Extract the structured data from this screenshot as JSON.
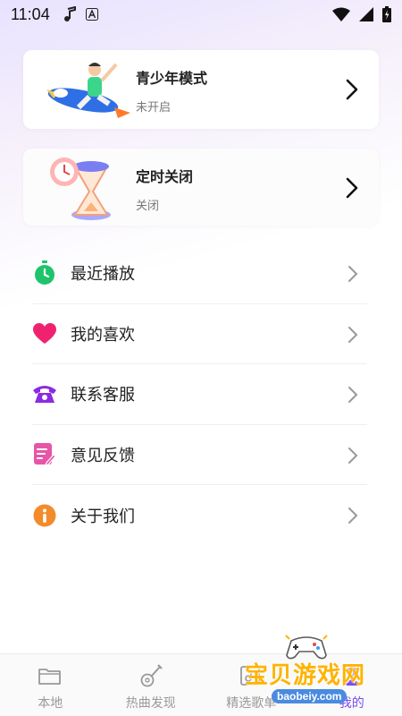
{
  "status_bar": {
    "time": "11:04"
  },
  "cards": [
    {
      "title": "青少年模式",
      "subtitle": "未开启"
    },
    {
      "title": "定时关闭",
      "subtitle": "关闭"
    }
  ],
  "menu": {
    "items": [
      {
        "label": "最近播放",
        "icon": "stopwatch-icon",
        "color": "#1ec46b"
      },
      {
        "label": "我的喜欢",
        "icon": "heart-icon",
        "color": "#f0226f"
      },
      {
        "label": "联系客服",
        "icon": "telephone-icon",
        "color": "#8a2be2"
      },
      {
        "label": "意见反馈",
        "icon": "feedback-icon",
        "color": "#e756a6"
      },
      {
        "label": "关于我们",
        "icon": "info-icon",
        "color": "#f38b2a"
      }
    ]
  },
  "bottom_nav": {
    "items": [
      {
        "label": "本地",
        "icon": "folder-icon"
      },
      {
        "label": "热曲发现",
        "icon": "guitar-icon"
      },
      {
        "label": "精选歌单",
        "icon": "playlist-icon"
      },
      {
        "label": "我的",
        "icon": "profile-icon",
        "active": true
      }
    ]
  },
  "watermark": {
    "text": "宝贝游戏网",
    "url": "baobeiy.com"
  },
  "colors": {
    "accent": "#7a4cf0",
    "background_top": "#e8e2ff"
  }
}
